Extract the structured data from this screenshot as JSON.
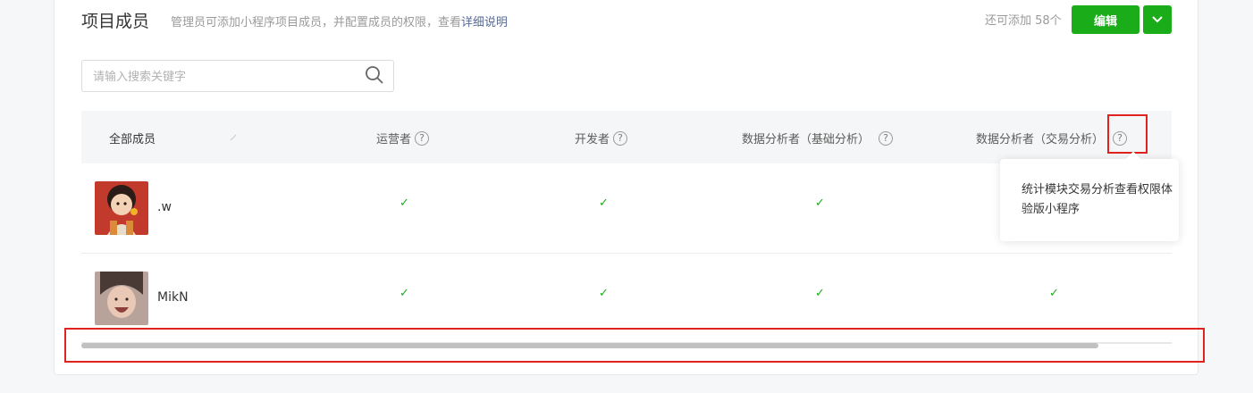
{
  "header": {
    "title": "项目成员",
    "desc_prefix": "管理员可添加小程序项目成员，并配置成员的权限，查看",
    "desc_link": "详细说明",
    "quota": "还可添加 58个",
    "edit_label": "编辑",
    "accent_color": "#1aad19"
  },
  "search": {
    "placeholder": "请输入搜索关键字",
    "value": ""
  },
  "table": {
    "columns": [
      "全部成员",
      "运营者",
      "开发者",
      "数据分析者（基础分析）",
      "数据分析者（交易分析）"
    ],
    "help_glyph": "?",
    "rows": [
      {
        "name": ".w",
        "checks": [
          "✓",
          "✓",
          "✓",
          ""
        ]
      },
      {
        "name": "MikN",
        "checks": [
          "✓",
          "✓",
          "✓",
          "✓"
        ]
      }
    ]
  },
  "tooltip": {
    "text": "统计模块交易分析查看权限体验版小程序"
  }
}
